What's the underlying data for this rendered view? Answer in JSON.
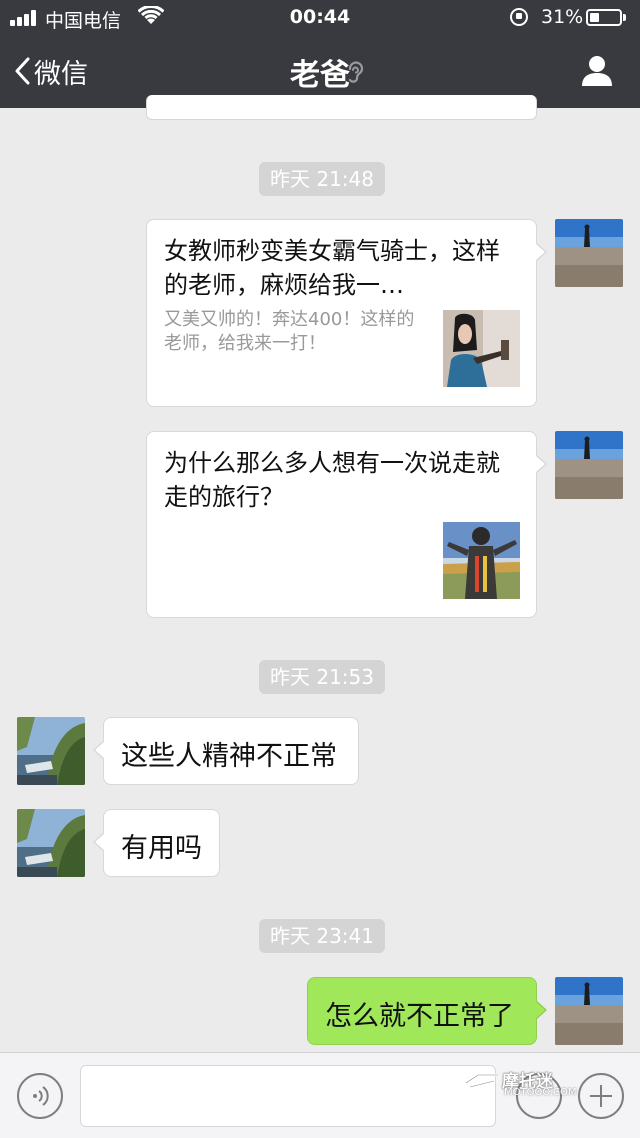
{
  "status_bar": {
    "carrier": "中国电信",
    "time": "00:44",
    "battery": "31%",
    "battery_level": 0.31
  },
  "nav": {
    "back_label": "微信",
    "title": "老爸"
  },
  "messages": [
    {
      "type": "timestamp",
      "text": "昨天 21:48"
    },
    {
      "type": "link-card",
      "side": "right",
      "title": "女教师秒变美女霸气骑士，这样的老师，麻烦给我一…",
      "description": "又美又帅的！奔达400！这样的老师，给我来一打！"
    },
    {
      "type": "link-card",
      "side": "right",
      "title": "为什么那么多人想有一次说走就走的旅行？",
      "description": ""
    },
    {
      "type": "timestamp",
      "text": "昨天 21:53"
    },
    {
      "type": "text",
      "side": "left",
      "text": "这些人精神不正常"
    },
    {
      "type": "text",
      "side": "left",
      "text": "有用吗"
    },
    {
      "type": "timestamp",
      "text": "昨天 23:41"
    },
    {
      "type": "text",
      "side": "right",
      "text": "怎么就不正常了"
    }
  ],
  "watermark": {
    "main": "摩托迷",
    "sub": "MOTOOO.COM"
  },
  "colors": {
    "nav_bg": "#393a3f",
    "chat_bg": "#ebebeb",
    "sent_bubble": "#a0e75a",
    "received_bubble": "#ffffff"
  }
}
